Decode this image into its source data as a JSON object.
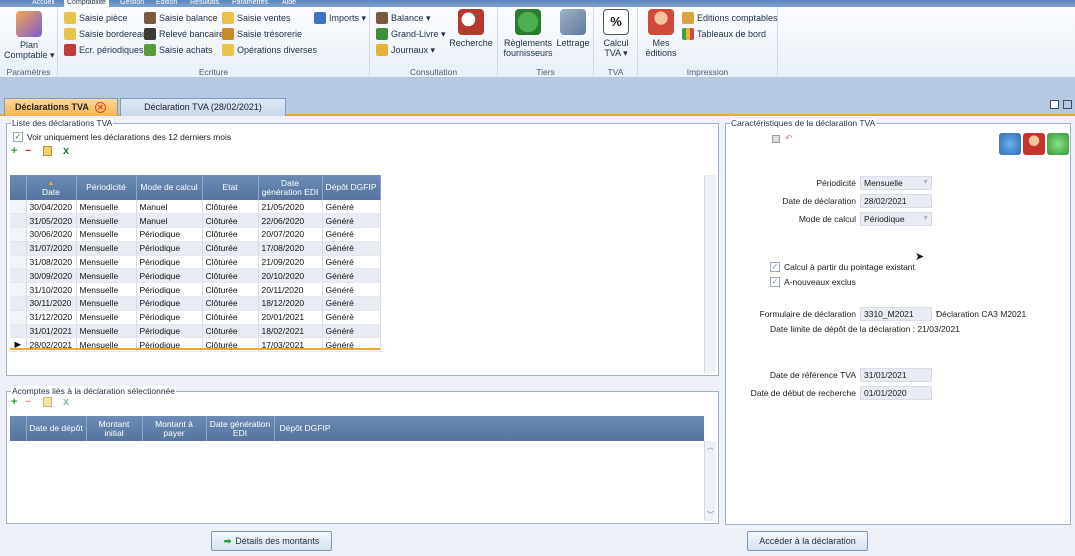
{
  "menu": {
    "tabs": [
      "Accueil",
      "Comptabilité",
      "Gestion",
      "Edition",
      "Résultats",
      "Paramètres",
      "Aide"
    ]
  },
  "ribbon": {
    "parametres": {
      "plan_label": "Plan\nComptable ▾",
      "group": "Paramètres"
    },
    "ecriture": {
      "group": "Ecriture",
      "items": [
        "Saisie pièce",
        "Saisie bordereau",
        "Ecr. périodiques",
        "Saisie balance",
        "Relevé bancaire",
        "Saisie achats",
        "Saisie ventes",
        "Saisie trésorerie",
        "Opérations diverses",
        "Imports ▾"
      ]
    },
    "consultation": {
      "group": "Consultation",
      "balance": "Balance ▾",
      "grand_livre": "Grand-Livre ▾",
      "journaux": "Journaux ▾",
      "recherche": "Recherche"
    },
    "tiers": {
      "group": "Tiers",
      "reglements": "Règlements\nfournisseurs",
      "lettrage": "Lettrage"
    },
    "tva": {
      "group": "TVA",
      "calcul": "Calcul\nTVA ▾"
    },
    "impression": {
      "group": "Impression",
      "mes_editions": "Mes\néditions",
      "editions_comptables": "Editions comptables",
      "tableaux_de_bord": "Tableaux de bord"
    }
  },
  "doc_tabs": {
    "active": "Déclarations TVA",
    "inactive": "Déclaration TVA (28/02/2021)"
  },
  "liste": {
    "title": "Liste des déclarations TVA",
    "checkbox_label": "Voir uniquement les déclarations des 12 derniers mois",
    "columns": [
      "Date",
      "Périodicité",
      "Mode de calcul",
      "Etat",
      "Date génération EDI",
      "Dépôt DGFIP"
    ],
    "rows": [
      [
        "30/04/2020",
        "Mensuelle",
        "Manuel",
        "Clôturée",
        "21/05/2020",
        "Généré"
      ],
      [
        "31/05/2020",
        "Mensuelle",
        "Manuel",
        "Clôturée",
        "22/06/2020",
        "Généré"
      ],
      [
        "30/06/2020",
        "Mensuelle",
        "Périodique",
        "Clôturée",
        "20/07/2020",
        "Généré"
      ],
      [
        "31/07/2020",
        "Mensuelle",
        "Périodique",
        "Clôturée",
        "17/08/2020",
        "Généré"
      ],
      [
        "31/08/2020",
        "Mensuelle",
        "Périodique",
        "Clôturée",
        "21/09/2020",
        "Généré"
      ],
      [
        "30/09/2020",
        "Mensuelle",
        "Périodique",
        "Clôturée",
        "20/10/2020",
        "Généré"
      ],
      [
        "31/10/2020",
        "Mensuelle",
        "Périodique",
        "Clôturée",
        "20/11/2020",
        "Généré"
      ],
      [
        "30/11/2020",
        "Mensuelle",
        "Périodique",
        "Clôturée",
        "18/12/2020",
        "Généré"
      ],
      [
        "31/12/2020",
        "Mensuelle",
        "Périodique",
        "Clôturée",
        "20/01/2021",
        "Généré"
      ],
      [
        "31/01/2021",
        "Mensuelle",
        "Périodique",
        "Clôturée",
        "18/02/2021",
        "Généré"
      ],
      [
        "28/02/2021",
        "Mensuelle",
        "Périodique",
        "Clôturée",
        "17/03/2021",
        "Généré"
      ]
    ]
  },
  "acomptes": {
    "title": "Acomptes liés à la déclaration sélectionnée",
    "columns": [
      "Date de dépôt",
      "Montant initial",
      "Montant à payer",
      "Date génération EDI",
      "Dépôt DGFIP"
    ]
  },
  "carac": {
    "title": "Caractéristiques de la déclaration TVA",
    "periodicite_label": "Périodicité",
    "periodicite": "Mensuelle",
    "date_decl_label": "Date de déclaration",
    "date_decl": "28/02/2021",
    "mode_label": "Mode de calcul",
    "mode": "Périodique",
    "chk1": "Calcul à partir du pointage existant",
    "chk2": "A-nouveaux exclus",
    "formulaire_label": "Formulaire de déclaration",
    "formulaire": "3310_M2021",
    "formulaire_desc": "Déclaration CA3 M2021",
    "date_limite": "Date limite de dépôt de la déclaration : 21/03/2021",
    "ref_label": "Date de référence TVA",
    "ref": "31/01/2021",
    "debut_label": "Date de début de recherche",
    "debut": "01/01/2020"
  },
  "buttons": {
    "details": "Détails des montants",
    "acceder": "Accéder à la déclaration"
  }
}
